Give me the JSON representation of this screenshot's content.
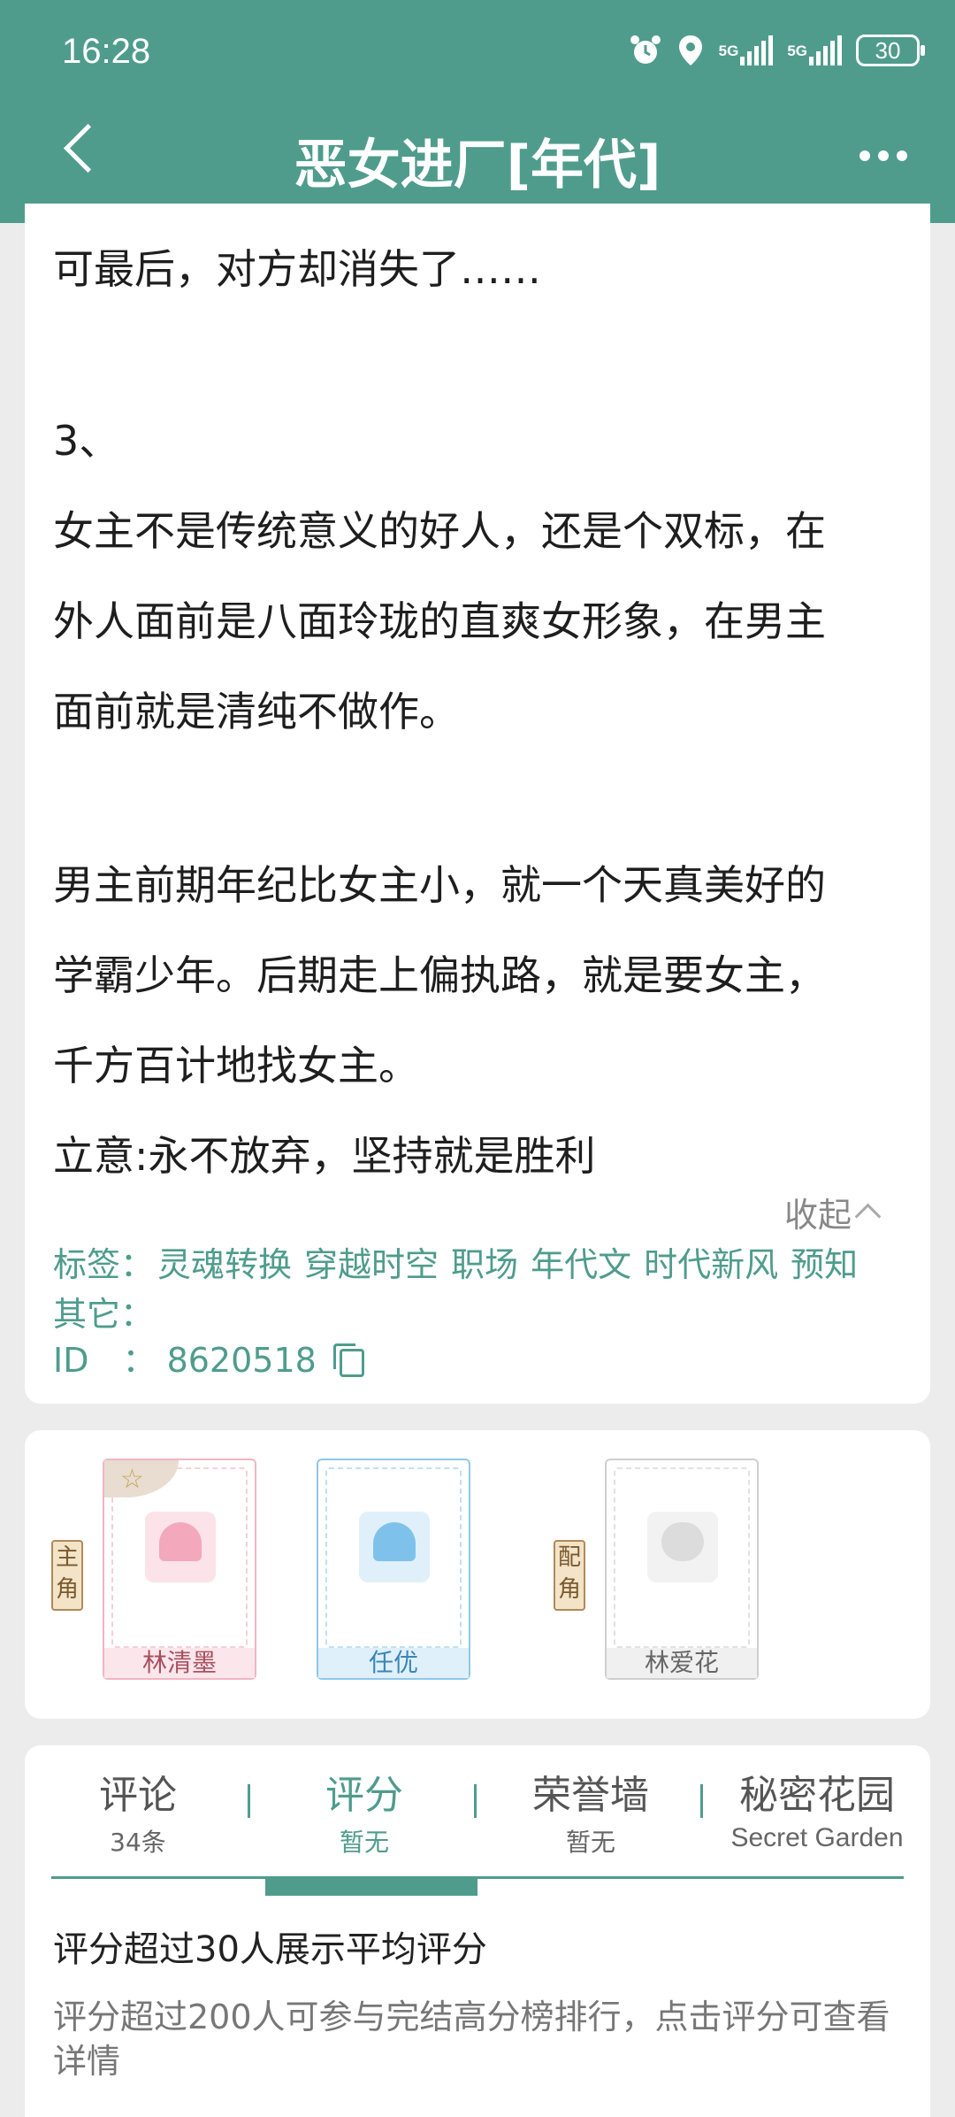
{
  "status_bar": {
    "time": "16:28",
    "network1": "5G",
    "network2": "5G",
    "battery": "30",
    "icons": [
      "alarm-icon",
      "location-icon",
      "signal-icon",
      "signal-icon",
      "battery-icon"
    ]
  },
  "header": {
    "title": "恶女进厂[年代]",
    "back_icon": "chevron-left-icon",
    "more_icon": "more-dots-icon"
  },
  "synopsis": {
    "lines": [
      "可最后，对方却消失了……",
      "3、",
      "女主不是传统意义的好人，还是个双标，在",
      "外人面前是八面玲珑的直爽女形象，在男主",
      "面前就是清纯不做作。",
      "男主前期年纪比女主小，就一个天真美好的",
      "学霸少年。后期走上偏执路，就是要女主，",
      "千方百计地找女主。",
      "立意:永不放弃，坚持就是胜利"
    ],
    "collapse_label": "收起"
  },
  "meta": {
    "tags_label": "标签：",
    "tags": [
      "灵魂转换",
      "穿越时空",
      "职场",
      "年代文",
      "时代新风",
      "预知"
    ],
    "other_label": "其它：",
    "id_label": "ID　：",
    "id_value": "8620518"
  },
  "characters": {
    "main_label": "主角",
    "supporting_label": "配角",
    "list": [
      {
        "name": "林清墨",
        "theme": "pink"
      },
      {
        "name": "任优",
        "theme": "blue"
      },
      {
        "name": "林爱花",
        "theme": "gray"
      }
    ]
  },
  "tabs": [
    {
      "label": "评论",
      "sub": "34条"
    },
    {
      "label": "评分",
      "sub": "暂无"
    },
    {
      "label": "荣誉墙",
      "sub": "暂无"
    },
    {
      "label": "秘密花园",
      "sub": "Secret Garden"
    }
  ],
  "active_tab": "评分",
  "rating": {
    "title": "评分超过30人展示平均评分",
    "description": "评分超过200人可参与完结高分榜排行，点击评分可查看详情"
  },
  "colors": {
    "brand": "#4f9c8d",
    "background": "#ececec"
  }
}
